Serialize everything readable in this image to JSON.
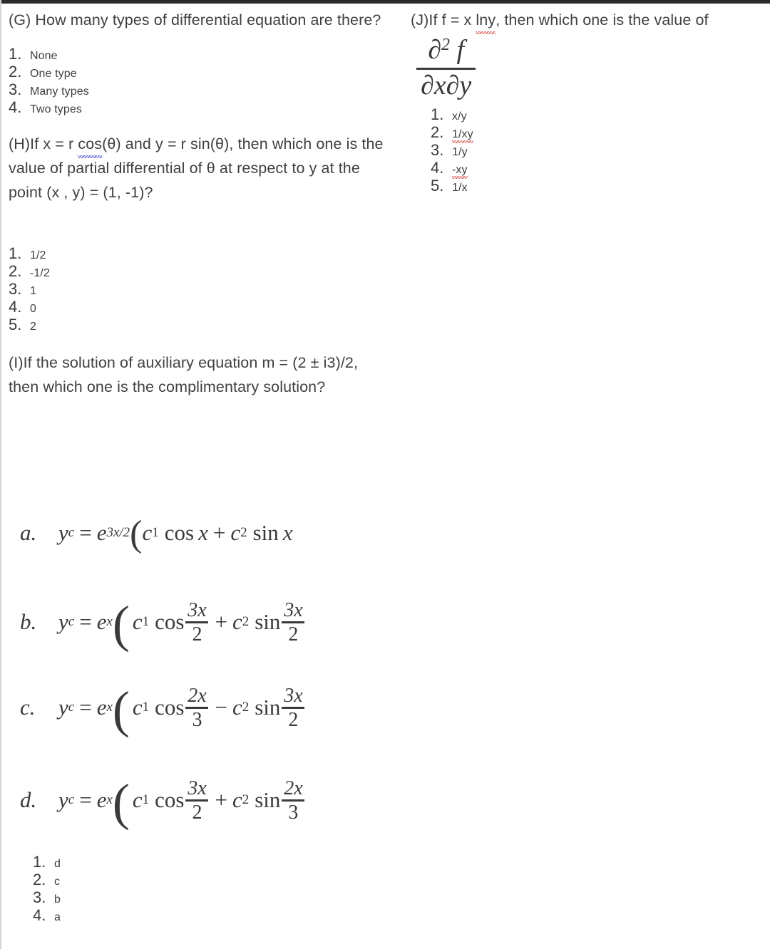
{
  "page": {
    "background": "#ffffff",
    "text_color": "#3c3c3c",
    "spellcheck_red": "#d9534f",
    "spellcheck_blue": "#5a5fd0"
  },
  "left_column": {
    "question_g": {
      "stem": "(G) How many types of differential equation are there?",
      "options": [
        {
          "num": "1.",
          "text": "None"
        },
        {
          "num": "2.",
          "text": "One type"
        },
        {
          "num": "3.",
          "text": "Many types"
        },
        {
          "num": "4.",
          "text": "Two types"
        }
      ]
    },
    "question_h": {
      "stem_part1": "(H)If x = r ",
      "stem_misspelled": "cos",
      "stem_part2": "(θ) and y = r sin(θ), then which one is the value of partial differential of θ at respect to y at the point (x , y) = (1, -1)?",
      "options": [
        {
          "num": "1.",
          "text": "1/2"
        },
        {
          "num": "2.",
          "text": "-1/2"
        },
        {
          "num": "3.",
          "text": "1"
        },
        {
          "num": "4.",
          "text": "0"
        },
        {
          "num": "5.",
          "text": "2"
        }
      ]
    },
    "question_i": {
      "stem": "(I)If the solution of auxiliary equation m = (2 ± i3)/2, then which one is the complimentary solution?",
      "choices": [
        {
          "tag": "a.",
          "lhs": "y",
          "lhs_sub": "c",
          "eq": "=",
          "base": "e",
          "exponent": "3x/2",
          "open_paren": "(",
          "coef1": "c",
          "coef1_sub": "1",
          "trig1": "cos",
          "arg1": "x",
          "operator": "+",
          "coef2": "c",
          "coef2_sub": "2",
          "trig2": "sin",
          "arg2_clipped": "x"
        },
        {
          "tag": "b.",
          "lhs": "y",
          "lhs_sub": "c",
          "eq": "=",
          "base": "e",
          "exponent": "x",
          "open_paren": "(",
          "coef1": "c",
          "coef1_sub": "1",
          "trig1": "cos",
          "arg1_num": "3x",
          "arg1_den": "2",
          "operator": "+",
          "coef2": "c",
          "coef2_sub": "2",
          "trig2": "sin",
          "arg2_num": "3x",
          "arg2_den": "2"
        },
        {
          "tag": "c.",
          "lhs": "y",
          "lhs_sub": "c",
          "eq": "=",
          "base": "e",
          "exponent": "x",
          "open_paren": "(",
          "coef1": "c",
          "coef1_sub": "1",
          "trig1": "cos",
          "arg1_num": "2x",
          "arg1_den": "3",
          "operator": "−",
          "coef2": "c",
          "coef2_sub": "2",
          "trig2": "sin",
          "arg2_num": "3x",
          "arg2_den": "2"
        },
        {
          "tag": "d.",
          "lhs": "y",
          "lhs_sub": "c",
          "eq": "=",
          "base": "e",
          "exponent": "x",
          "open_paren": "(",
          "coef1": "c",
          "coef1_sub": "1",
          "trig1": "cos",
          "arg1_num": "3x",
          "arg1_den": "2",
          "operator": "+",
          "coef2": "c",
          "coef2_sub": "2",
          "trig2": "sin",
          "arg2_num": "2x",
          "arg2_den": "3"
        }
      ],
      "options": [
        {
          "num": "1.",
          "text": "d"
        },
        {
          "num": "2.",
          "text": "c"
        },
        {
          "num": "3.",
          "text": "b"
        },
        {
          "num": "4.",
          "text": "a"
        }
      ]
    }
  },
  "right_column": {
    "question_j": {
      "stem_part1": "(J)If f = x ",
      "stem_misspelled": "lny",
      "stem_part2": ", then which one is the value of",
      "derivative": {
        "numerator": "∂",
        "numerator_power": "2",
        "numerator_fn": "f",
        "denominator": "∂x∂y"
      },
      "options": [
        {
          "num": "1.",
          "text": "x/y",
          "misspelled": false
        },
        {
          "num": "2.",
          "text": "1/xy",
          "misspelled": true
        },
        {
          "num": "3.",
          "text": "1/y",
          "misspelled": false
        },
        {
          "num": "4.",
          "text": "-xy",
          "misspelled": true
        },
        {
          "num": "5.",
          "text": "1/x",
          "misspelled": false
        }
      ]
    }
  }
}
